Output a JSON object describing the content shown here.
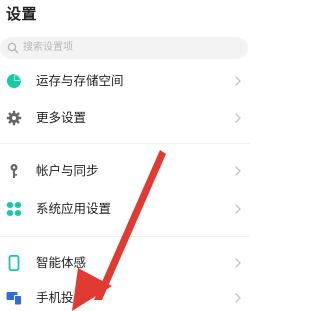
{
  "header": {
    "title": "设置"
  },
  "search": {
    "placeholder": "搜索设置项",
    "icon": "search-icon"
  },
  "settings_items": [
    {
      "label": "运存与存储空间",
      "icon": "storage-pie-icon",
      "icon_color": "#18c9a3"
    },
    {
      "label": "更多设置",
      "icon": "gear-icon",
      "icon_color": "#666666"
    },
    {
      "label": "帐户与同步",
      "icon": "key-icon",
      "icon_color": "#666666"
    },
    {
      "label": "系统应用设置",
      "icon": "apps-grid-icon",
      "icon_color": "#18c9a3"
    },
    {
      "label": "智能体感",
      "icon": "phone-outline-icon",
      "icon_color": "#18c9a3"
    },
    {
      "label": "手机投屏",
      "icon": "screen-cast-icon",
      "icon_color": "#2f6ddb"
    }
  ],
  "colors": {
    "accent_teal": "#18c9a3",
    "accent_blue": "#2f6ddb",
    "annotation_red": "#e03a32",
    "chevron": "#c4c4c4"
  }
}
